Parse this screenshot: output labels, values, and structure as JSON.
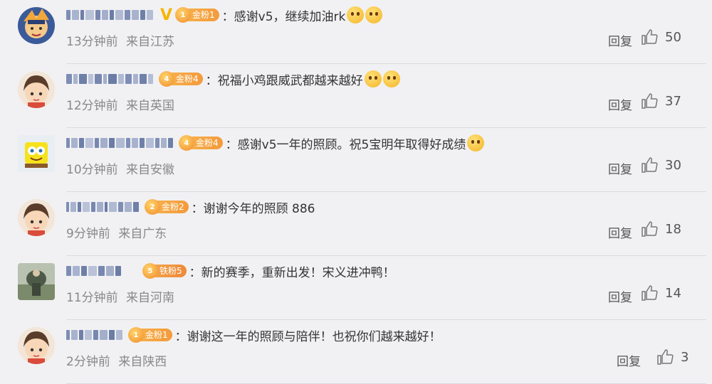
{
  "comments": [
    {
      "badge_level": "1",
      "badge_label": "金粉1",
      "badge_kind": "gold",
      "text": "感谢v5，继续加油rk",
      "emoji_count": 2,
      "verified": true,
      "time": "13分钟前",
      "location": "来自江苏",
      "reply": "回复",
      "likes": "50",
      "avatar": "naruto"
    },
    {
      "badge_level": "4",
      "badge_label": "金粉4",
      "badge_kind": "gold",
      "text": "祝福小鸡跟威武都越来越好",
      "emoji_count": 2,
      "verified": false,
      "time": "12分钟前",
      "location": "来自英国",
      "reply": "回复",
      "likes": "37",
      "avatar": "boy"
    },
    {
      "badge_level": "4",
      "badge_label": "金粉4",
      "badge_kind": "gold",
      "text": "感谢v5一年的照顾。祝5宝明年取得好成绩",
      "emoji_count": 1,
      "verified": false,
      "time": "10分钟前",
      "location": "来自安徽",
      "reply": "回复",
      "likes": "30",
      "avatar": "sponge"
    },
    {
      "badge_level": "2",
      "badge_label": "金粉2",
      "badge_kind": "gold",
      "text": "谢谢今年的照顾 886",
      "emoji_count": 0,
      "verified": false,
      "time": "9分钟前",
      "location": "来自广东",
      "reply": "回复",
      "likes": "18",
      "avatar": "boy"
    },
    {
      "badge_level": "5",
      "badge_label": "铁粉5",
      "badge_kind": "iron",
      "text": "新的赛季，重新出发！宋义进冲鸭！",
      "emoji_count": 0,
      "verified": false,
      "time": "11分钟前",
      "location": "来自河南",
      "reply": "回复",
      "likes": "14",
      "avatar": "photo"
    },
    {
      "badge_level": "1",
      "badge_label": "金粉1",
      "badge_kind": "gold",
      "text": "谢谢这一年的照顾与陪伴！也祝你们越来越好！",
      "emoji_count": 0,
      "verified": false,
      "time": "2分钟前",
      "location": "来自陕西",
      "reply": "回复",
      "likes": "3",
      "avatar": "boy"
    }
  ],
  "colon": "："
}
